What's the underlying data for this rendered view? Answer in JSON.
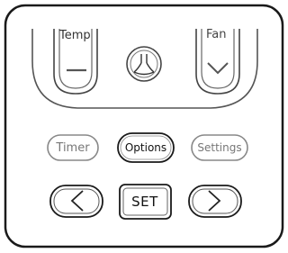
{
  "remote": {
    "top_controls": {
      "temp_label": "Temp",
      "fan_label": "Fan"
    },
    "pill_buttons": {
      "timer_label": "Timer",
      "options_label": "Options",
      "settings_label": "Settings"
    },
    "nav": {
      "set_label": "SET"
    },
    "icons": {
      "temp_down": "minus-icon",
      "swing": "swing-icon",
      "fan_down": "chevron-down-icon",
      "left": "chevron-left-icon",
      "right": "chevron-right-icon"
    },
    "colors": {
      "outline": "#1a1a1a",
      "muted": "#888888"
    }
  }
}
